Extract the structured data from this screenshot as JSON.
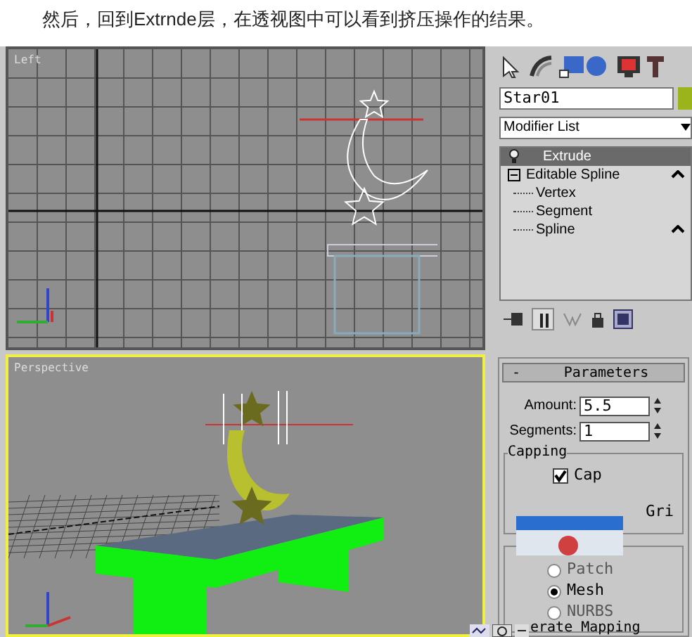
{
  "caption": "然后，回到Extrnde层，在透视图中可以看到挤压操作的结果。",
  "viewports": [
    {
      "label": "Left",
      "kind": "wire",
      "selected": false
    },
    {
      "label": "Perspective",
      "kind": "shaded",
      "selected": true
    }
  ],
  "command_panel": {
    "object_name": "Star01",
    "modifier_list": "Modifier List",
    "stack": [
      {
        "label": "Extrude",
        "selected": true
      },
      {
        "label": "Editable Spline",
        "selected": false,
        "expanded": true,
        "children": [
          {
            "label": "Vertex"
          },
          {
            "label": "Segment"
          },
          {
            "label": "Spline"
          }
        ]
      }
    ]
  },
  "parameters": {
    "collapse": "-",
    "title": "Parameters",
    "amount": {
      "label": "Amount:",
      "value": "5.5"
    },
    "segments": {
      "label": "Segments:",
      "value": "1"
    },
    "capping": {
      "title": "Capping",
      "options": [
        {
          "label": "Cap",
          "checked": true
        }
      ],
      "partial_label": "Gri"
    },
    "output": {
      "options": [
        {
          "label": "Patch",
          "selected": false
        },
        {
          "label": "Mesh",
          "selected": true
        },
        {
          "label": "NURBS",
          "selected": false
        }
      ]
    },
    "bottom_label": "erate Mapping"
  }
}
